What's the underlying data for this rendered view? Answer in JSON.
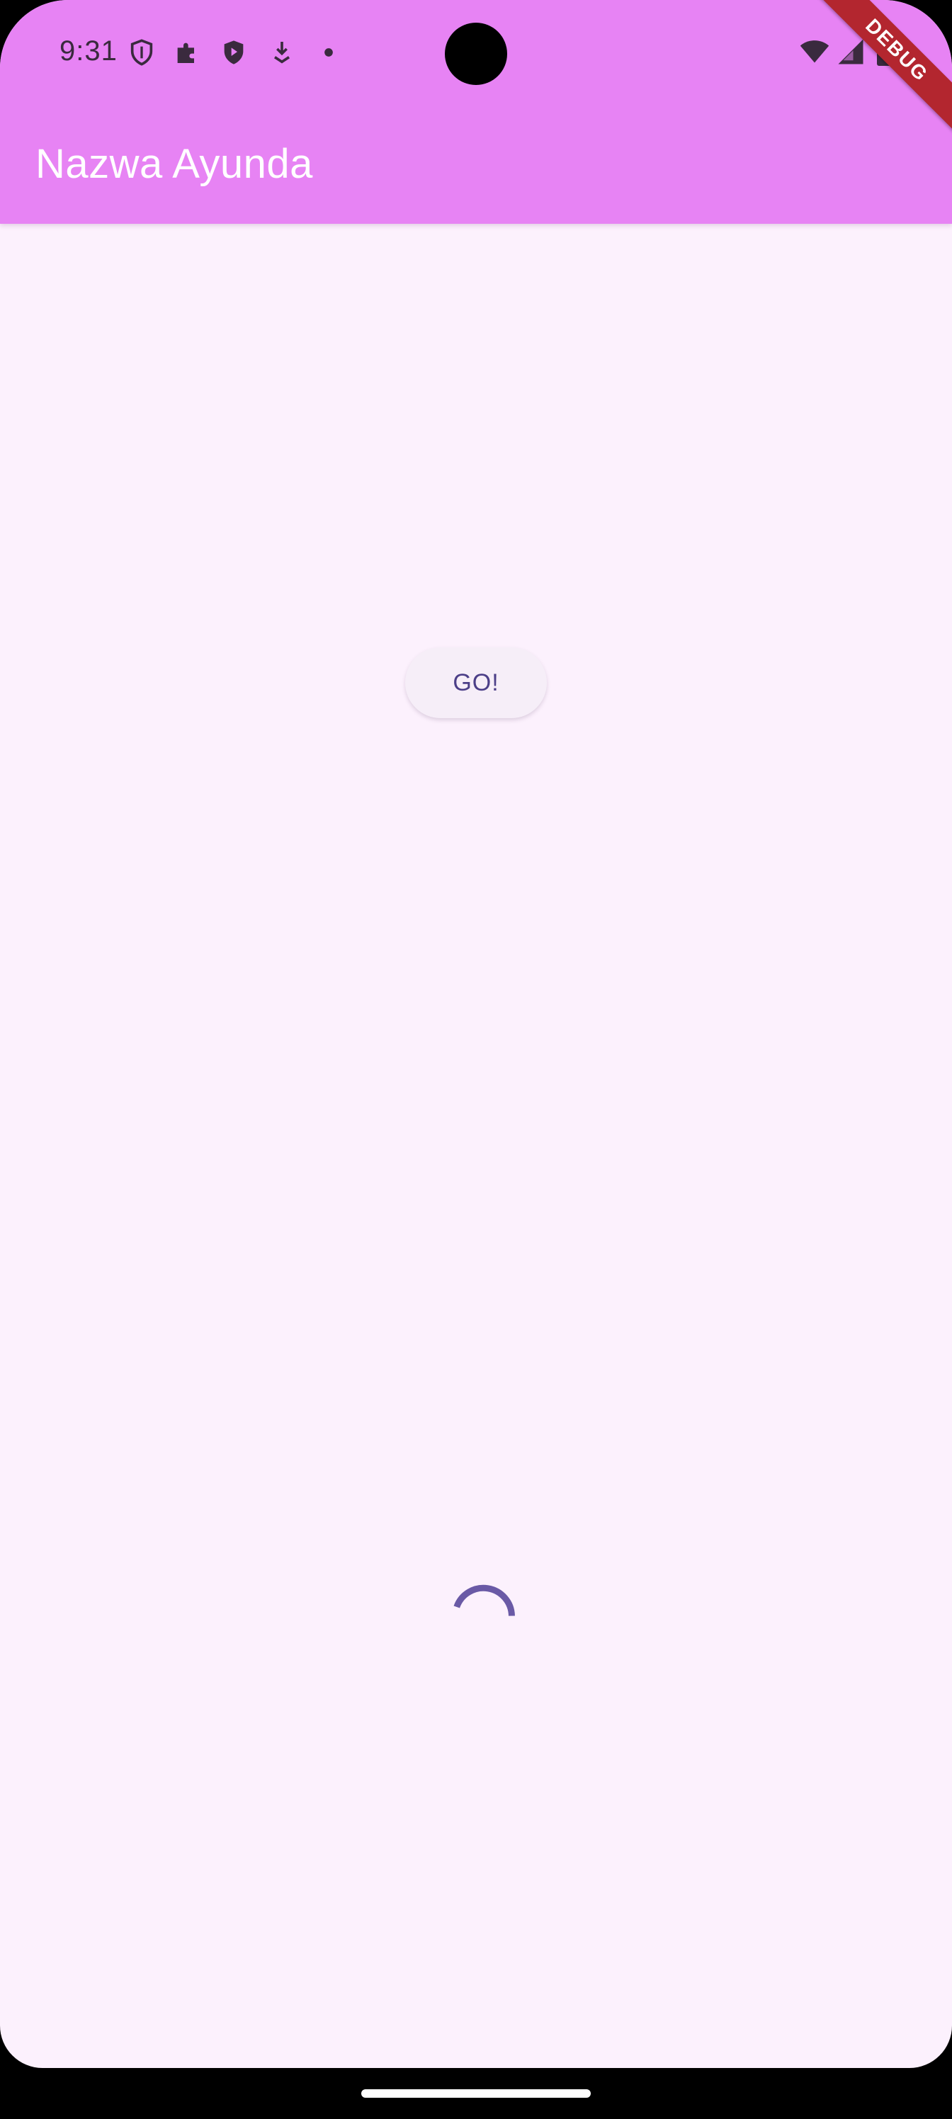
{
  "status_bar": {
    "time": "9:31",
    "left_icons": [
      "shield-icon",
      "puzzle-icon",
      "play-shield-icon",
      "download-icon",
      "dot-icon"
    ],
    "right_icons": [
      "wifi-icon",
      "signal-icon",
      "battery-icon"
    ]
  },
  "app_bar": {
    "title": "Nazwa Ayunda",
    "background": "#e783f4"
  },
  "debug_banner": {
    "label": "DEBUG",
    "color": "#b3262f"
  },
  "main": {
    "go_button_label": "GO!",
    "background": "#fcf1fd",
    "spinner_color": "#6a5aa6"
  }
}
